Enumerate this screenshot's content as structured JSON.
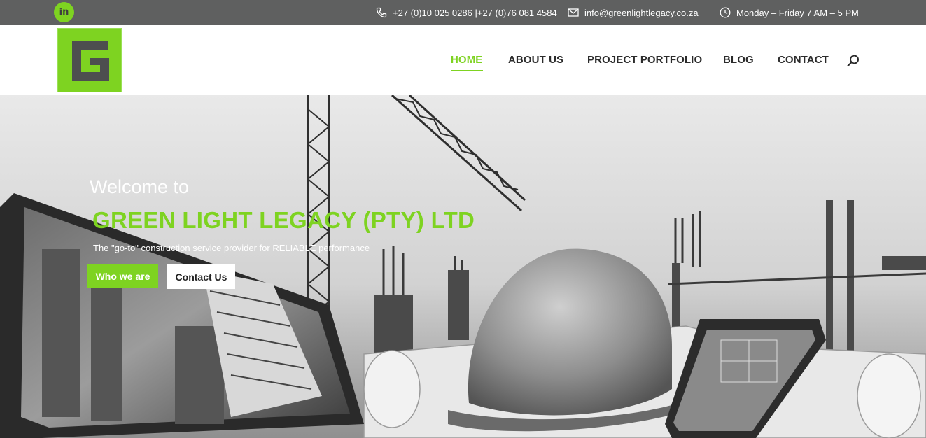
{
  "topbar": {
    "social_icon": "linkedin-icon",
    "social_label": "in",
    "phone": "+27 (0)10 025 0286 |+27 (0)76 081 4584",
    "email": "info@greenlightlegacy.co.za",
    "hours": "Monday – Friday 7 AM – 5 PM"
  },
  "header": {
    "logo_letter": "G",
    "nav": [
      {
        "label": "HOME",
        "active": true
      },
      {
        "label": "ABOUT US"
      },
      {
        "label": "PROJECT PORTFOLIO"
      },
      {
        "label": "BLOG"
      },
      {
        "label": "CONTACT"
      }
    ],
    "search_icon": "search-icon"
  },
  "hero": {
    "welcome": "Welcome to",
    "company": "GREEN LIGHT LEGACY (PTY) LTD",
    "tagline": "The \"go-to\" construction service provider for RELIABLE performance",
    "primary_button": "Who we are",
    "secondary_button": "Contact Us"
  },
  "colors": {
    "accent": "#7ed321",
    "topbar": "#5f6060",
    "nav_text": "#2b2b2b"
  }
}
